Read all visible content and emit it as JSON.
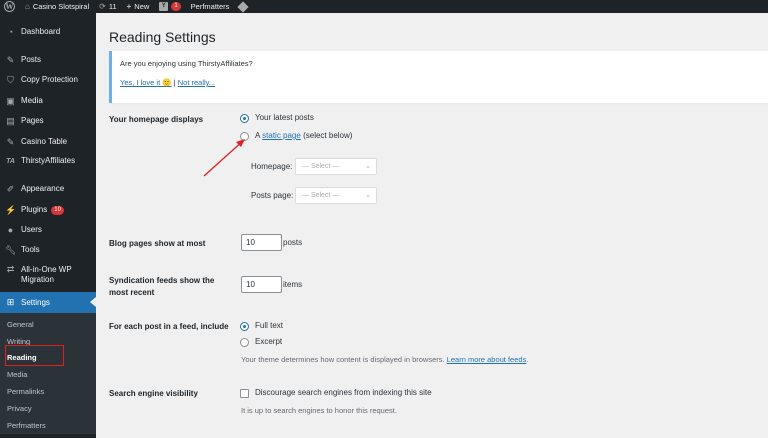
{
  "adminbar": {
    "site_name": "Casino Slotspiral",
    "updates_count": "11",
    "new_label": "New",
    "yoast_count": "1",
    "perfmatters_label": "Perfmatters"
  },
  "sidebar": {
    "items": [
      {
        "label": "Dashboard",
        "icon": "dashboard-icon"
      },
      {
        "label": "Posts",
        "icon": "pin-icon"
      },
      {
        "label": "Copy Protection",
        "icon": "shield-icon"
      },
      {
        "label": "Media",
        "icon": "media-icon"
      },
      {
        "label": "Pages",
        "icon": "pages-icon"
      },
      {
        "label": "Casino Table",
        "icon": "pin-icon"
      },
      {
        "label": "ThirstyAffiliates",
        "icon": "ta-icon"
      },
      {
        "label": "Appearance",
        "icon": "brush-icon"
      },
      {
        "label": "Plugins",
        "icon": "plugin-icon",
        "badge": "10"
      },
      {
        "label": "Users",
        "icon": "user-icon"
      },
      {
        "label": "Tools",
        "icon": "wrench-icon"
      },
      {
        "label": "All-in-One WP Migration",
        "icon": "migration-icon"
      },
      {
        "label": "Settings",
        "icon": "settings-icon"
      }
    ],
    "submenu": [
      "General",
      "Writing",
      "Reading",
      "Media",
      "Permalinks",
      "Privacy",
      "Perfmatters"
    ]
  },
  "page": {
    "title": "Reading Settings",
    "notice": {
      "text": "Are you enjoying using ThirstyAffiliates?",
      "yes_link": "Yes, I love it 🙂",
      "separator": "|",
      "no_link": "Not really..."
    },
    "homepage": {
      "label": "Your homepage displays",
      "option_latest": "Your latest posts",
      "option_static_prefix": "A",
      "option_static_link": "static page",
      "option_static_suffix": "(select below)",
      "homepage_label": "Homepage:",
      "posts_page_label": "Posts page:",
      "select_placeholder": "— Select —"
    },
    "blog_pages": {
      "label": "Blog pages show at most",
      "value": "10",
      "unit": "posts"
    },
    "syndication": {
      "label_line1": "Syndication feeds show the",
      "label_line2": "most recent",
      "value": "10",
      "unit": "items"
    },
    "feed_include": {
      "label": "For each post in a feed, include",
      "option_full": "Full text",
      "option_excerpt": "Excerpt",
      "desc": "Your theme determines how content is displayed in browsers.",
      "desc_link": "Learn more about feeds"
    },
    "search_visibility": {
      "label": "Search engine visibility",
      "option": "Discourage search engines from indexing this site",
      "desc": "It is up to search engines to honor this request."
    }
  },
  "colors": {
    "accent": "#2271b1",
    "admin_bg": "#1d2327",
    "annotation": "#e02020"
  }
}
